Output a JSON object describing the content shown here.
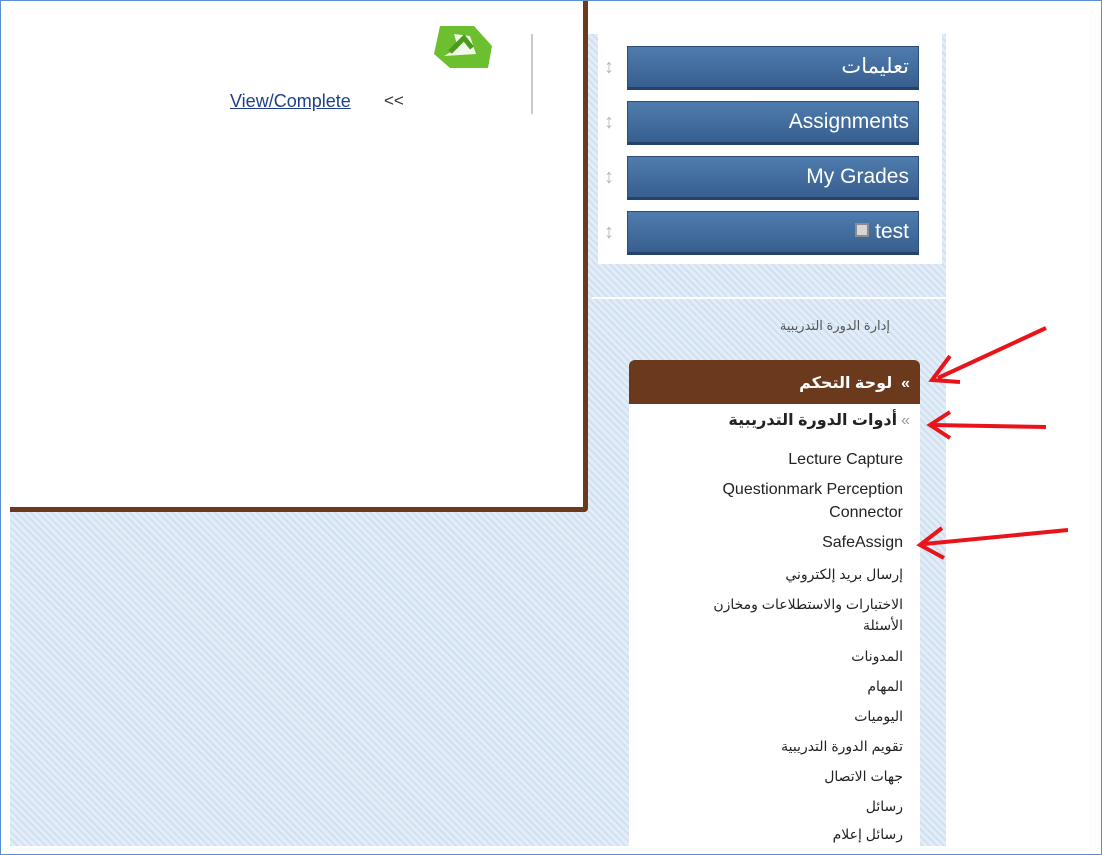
{
  "content": {
    "view_link": "View/Complete",
    "view_arrows": "<<"
  },
  "nav": {
    "items": [
      {
        "label": "تعليمات"
      },
      {
        "label": "Assignments"
      },
      {
        "label": "My Grades"
      },
      {
        "label": "test"
      }
    ]
  },
  "management": {
    "title": "إدارة الدورة التدريبية",
    "control_panel": "لوحة التحكم",
    "course_tools": "أدوات الدورة التدريبية",
    "items": [
      {
        "label": "Lecture Capture"
      },
      {
        "label": "Questionmark Perception Connector"
      },
      {
        "label": "SafeAssign"
      },
      {
        "label": "إرسال بريد إلكتروني"
      },
      {
        "label": "الاختبارات والاستطلاعات ومخازن الأسئلة"
      },
      {
        "label": "المدونات"
      },
      {
        "label": "المهام"
      },
      {
        "label": "اليوميات"
      },
      {
        "label": "تقويم الدورة التدريبية"
      },
      {
        "label": "جهات الاتصال"
      },
      {
        "label": "رسائل"
      },
      {
        "label": "رسائل إعلام"
      }
    ]
  },
  "colors": {
    "nav_button": "#375f8f",
    "control_panel": "#6b3a1d",
    "annotation_arrow": "#e8141a"
  }
}
